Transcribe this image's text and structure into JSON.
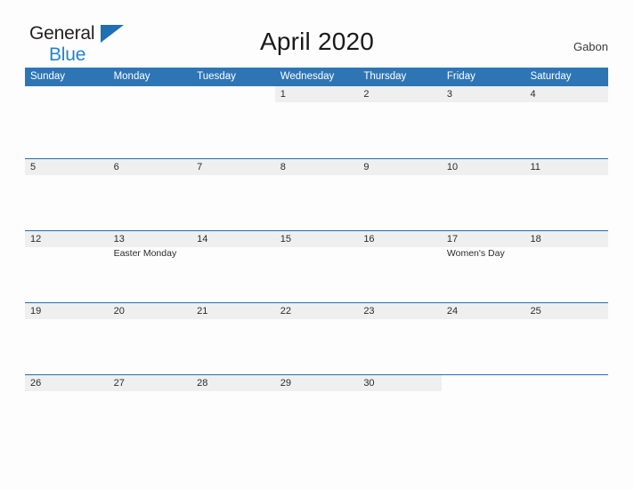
{
  "brand": {
    "line1": "General",
    "line2": "Blue",
    "triangle_icon": "blue-flag-triangle-icon",
    "colors": {
      "dark": "#231f20",
      "blue": "#1f84d6",
      "triangle": "#1f6fb2"
    }
  },
  "header": {
    "title": "April 2020",
    "country": "Gabon"
  },
  "calendar": {
    "month": "April",
    "year": "2020",
    "accent_color": "#2e75b6",
    "band_color": "#efefef",
    "weekday_headers": [
      "Sunday",
      "Monday",
      "Tuesday",
      "Wednesday",
      "Thursday",
      "Friday",
      "Saturday"
    ],
    "weeks": [
      [
        {
          "day": "",
          "event": ""
        },
        {
          "day": "",
          "event": ""
        },
        {
          "day": "",
          "event": ""
        },
        {
          "day": "1",
          "event": ""
        },
        {
          "day": "2",
          "event": ""
        },
        {
          "day": "3",
          "event": ""
        },
        {
          "day": "4",
          "event": ""
        }
      ],
      [
        {
          "day": "5",
          "event": ""
        },
        {
          "day": "6",
          "event": ""
        },
        {
          "day": "7",
          "event": ""
        },
        {
          "day": "8",
          "event": ""
        },
        {
          "day": "9",
          "event": ""
        },
        {
          "day": "10",
          "event": ""
        },
        {
          "day": "11",
          "event": ""
        }
      ],
      [
        {
          "day": "12",
          "event": ""
        },
        {
          "day": "13",
          "event": "Easter Monday"
        },
        {
          "day": "14",
          "event": ""
        },
        {
          "day": "15",
          "event": ""
        },
        {
          "day": "16",
          "event": ""
        },
        {
          "day": "17",
          "event": "Women's Day"
        },
        {
          "day": "18",
          "event": ""
        }
      ],
      [
        {
          "day": "19",
          "event": ""
        },
        {
          "day": "20",
          "event": ""
        },
        {
          "day": "21",
          "event": ""
        },
        {
          "day": "22",
          "event": ""
        },
        {
          "day": "23",
          "event": ""
        },
        {
          "day": "24",
          "event": ""
        },
        {
          "day": "25",
          "event": ""
        }
      ],
      [
        {
          "day": "26",
          "event": ""
        },
        {
          "day": "27",
          "event": ""
        },
        {
          "day": "28",
          "event": ""
        },
        {
          "day": "29",
          "event": ""
        },
        {
          "day": "30",
          "event": ""
        },
        {
          "day": "",
          "event": ""
        },
        {
          "day": "",
          "event": ""
        }
      ]
    ]
  }
}
